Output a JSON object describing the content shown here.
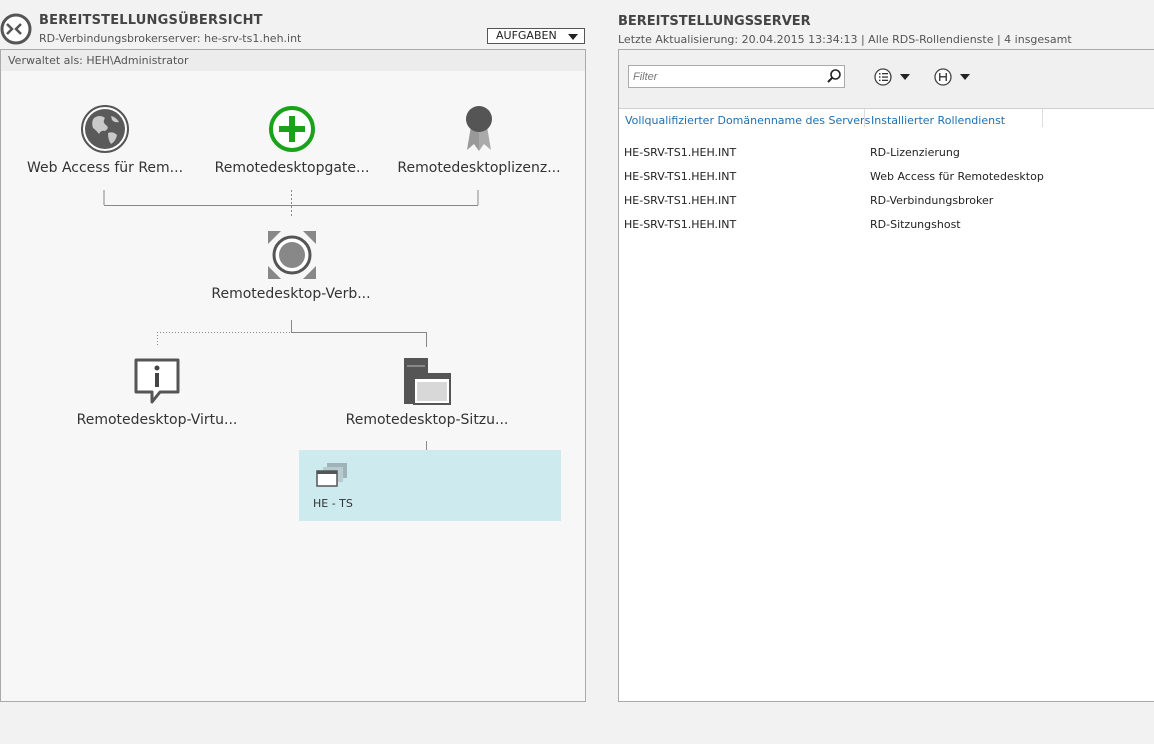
{
  "overview": {
    "title": "BEREITSTELLUNGSÜBERSICHT",
    "subtitle": "RD-Verbindungsbrokerserver: he-srv-ts1.heh.int",
    "tasks_label": "AUFGABEN",
    "managed_as": "Verwaltet als: HEH\\Administrator",
    "nodes": {
      "web_access": "Web Access für Rem...",
      "gateway": "Remotedesktopgate...",
      "licensing": "Remotedesktoplizenz...",
      "broker": "Remotedesktop-Verb...",
      "virtualization": "Remotedesktop-Virtu...",
      "session_host": "Remotedesktop-Sitzu..."
    },
    "collection": {
      "label": "HE - TS"
    }
  },
  "servers": {
    "title": "BEREITSTELLUNGSSERVER",
    "subtitle": "Letzte Aktualisierung: 20.04.2015 13:34:13 | Alle RDS-Rollendienste  | 4 insgesamt",
    "filter_placeholder": "Filter",
    "columns": [
      "Vollqualifizierter Domänenname des Servers",
      "Installierter Rollendienst"
    ],
    "rows": [
      {
        "fqdn": "HE-SRV-TS1.HEH.INT",
        "role": "RD-Lizenzierung"
      },
      {
        "fqdn": "HE-SRV-TS1.HEH.INT",
        "role": "Web Access für Remotedesktop"
      },
      {
        "fqdn": "HE-SRV-TS1.HEH.INT",
        "role": "RD-Verbindungsbroker"
      },
      {
        "fqdn": "HE-SRV-TS1.HEH.INT",
        "role": "RD-Sitzungshost"
      }
    ]
  },
  "colors": {
    "accent_link": "#1f6fb0",
    "tile_bg": "#cdeaee",
    "gateway_green": "#1aa31a"
  },
  "icons": {
    "header": "remote-desktop-icon",
    "web_access": "globe-icon",
    "gateway": "add-circle-icon",
    "licensing": "award-ribbon-icon",
    "broker": "broker-icon",
    "virtualization": "info-speech-icon",
    "session_host": "session-host-icon",
    "collection": "collection-windows-icon"
  }
}
